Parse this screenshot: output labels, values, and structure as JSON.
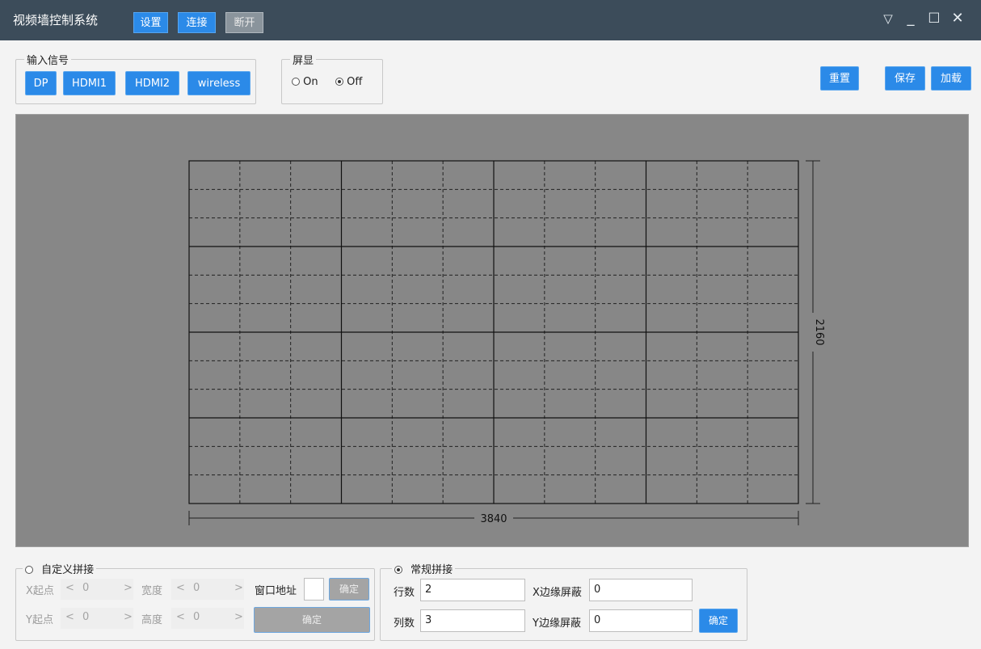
{
  "titlebar": {
    "title": "视频墙控制系统",
    "buttons": [
      "设置",
      "连接",
      "断开"
    ],
    "controls": [
      "filter-icon",
      "minimize-icon",
      "maximize-icon",
      "close-icon"
    ]
  },
  "input_signal": {
    "title": "输入信号",
    "buttons": [
      "DP",
      "HDMI1",
      "HDMI2",
      "wireless"
    ]
  },
  "screen_display": {
    "title": "屏显",
    "on_label": "On",
    "off_label": "Off",
    "selected": "Off"
  },
  "toolbar": {
    "reset": "重置",
    "save": "保存",
    "load": "加载"
  },
  "canvas": {
    "width_label": "3840",
    "height_label": "2160",
    "rows": 4,
    "cols": 4,
    "sub_rows": 3,
    "sub_cols": 3,
    "background_color": "#878787"
  },
  "custom_splice": {
    "title": "自定义拼接",
    "selected": false,
    "x_start_label": "X起点",
    "x_start_value": "0",
    "width_label": "宽度",
    "width_value": "0",
    "y_start_label": "Y起点",
    "y_start_value": "0",
    "height_label": "高度",
    "height_value": "0",
    "window_addr_label": "窗口地址",
    "window_addr_value": "",
    "confirm_small": "确定",
    "confirm_large": "确定"
  },
  "normal_splice": {
    "title": "常规拼接",
    "selected": true,
    "rows_label": "行数",
    "rows_value": "2",
    "cols_label": "列数",
    "cols_value": "3",
    "x_mask_label": "X边缘屏蔽",
    "x_mask_value": "0",
    "y_mask_label": "Y边缘屏蔽",
    "y_mask_value": "0",
    "confirm": "确定"
  },
  "colors": {
    "accent": "#2b8ae8",
    "titlebar": "#3c4c5a",
    "disabled": "#8a949c"
  }
}
